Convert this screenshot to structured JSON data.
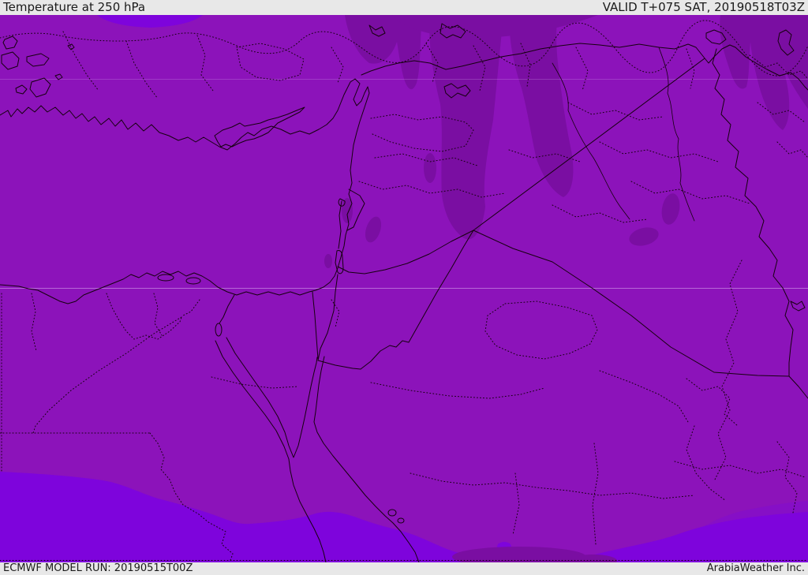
{
  "header": {
    "title": "Temperature at 250 hPa",
    "valid_time": "VALID T+075 SAT, 20190518T03Z"
  },
  "footer": {
    "model_run": "ECMWF MODEL RUN: 20190515T00Z",
    "credit": "ArabiaWeather Inc."
  },
  "map": {
    "kind": "temperature field at 250 hPa over the Middle East",
    "colors": {
      "base_fill": "#8C13BA",
      "cold_blob_fill": "#7A0EA2",
      "warm_band_fill": "#7E04DC",
      "warm_mid_fill": "#860FC6",
      "line": "#16000F",
      "graticule": "rgba(235,210,250,0.45)",
      "bar_background": "#e8e8e8",
      "bar_text": "#1a1a1a"
    }
  }
}
